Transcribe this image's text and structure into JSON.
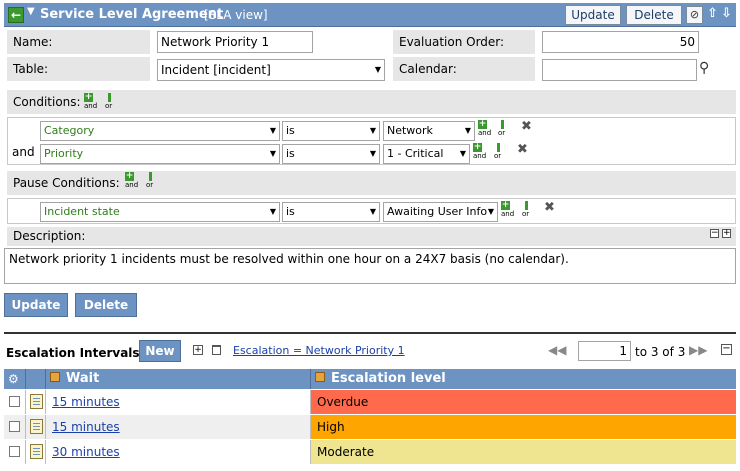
{
  "header": {
    "title": "Service Level Agreement",
    "subtitle": "[SLA view]",
    "update_label": "Update",
    "delete_label": "Delete"
  },
  "form": {
    "name_label": "Name:",
    "name_value": "Network Priority 1",
    "table_label": "Table:",
    "table_value": "Incident [incident]",
    "eval_label": "Evaluation Order:",
    "eval_value": "50",
    "calendar_label": "Calendar:",
    "calendar_value": ""
  },
  "conditions": {
    "label": "Conditions:",
    "and_label": "and",
    "rows": [
      {
        "field": "Category",
        "operator": "is",
        "value": "Network",
        "prefix": ""
      },
      {
        "field": "Priority",
        "operator": "is",
        "value": "1 - Critical",
        "prefix": "and"
      }
    ]
  },
  "pause_conditions": {
    "label": "Pause Conditions:",
    "rows": [
      {
        "field": "Incident state",
        "operator": "is",
        "value": "Awaiting User Info"
      }
    ]
  },
  "description": {
    "label": "Description:",
    "text": "Network priority 1 incidents must be resolved within one hour on a 24X7 basis (no calendar)."
  },
  "actions": {
    "update_label": "Update",
    "delete_label": "Delete"
  },
  "escalation": {
    "title": "Escalation Intervals",
    "new_label": "New",
    "filter_link": "Escalation = Network Priority 1",
    "page_value": "1",
    "page_range": "to 3 of 3",
    "columns": {
      "wait": "Wait",
      "level": "Escalation level"
    },
    "rows": [
      {
        "wait": "15 minutes",
        "level": "Overdue",
        "color": "#ff6a4d"
      },
      {
        "wait": "15 minutes",
        "level": "High",
        "color": "#ffa500"
      },
      {
        "wait": "30 minutes",
        "level": "Moderate",
        "color": "#efe48f"
      }
    ]
  }
}
